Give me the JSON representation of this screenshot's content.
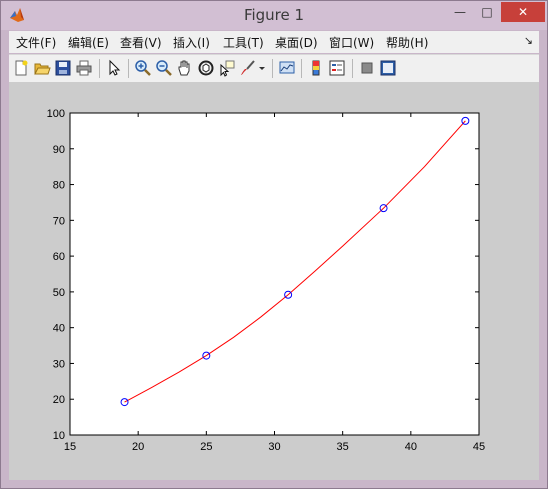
{
  "window": {
    "title": "Figure 1",
    "min_glyph": "—",
    "max_glyph": "□",
    "close_glyph": "✕"
  },
  "menu": {
    "items": [
      "文件(F)",
      "编辑(E)",
      "查看(V)",
      "插入(I)",
      "工具(T)",
      "桌面(D)",
      "窗口(W)",
      "帮助(H)"
    ],
    "overflow_glyph": "↘"
  },
  "toolbar": {
    "icons": [
      "new-figure-icon",
      "open-file-icon",
      "save-icon",
      "print-icon",
      "edit-plot-arrow-icon",
      "zoom-in-icon",
      "zoom-out-icon",
      "pan-hand-icon",
      "rotate-3d-icon",
      "data-cursor-icon",
      "brush-icon",
      "brush-dropdown-icon",
      "link-plot-icon",
      "colorbar-icon",
      "legend-icon",
      "hide-plot-tools-icon",
      "show-plot-tools-icon"
    ]
  },
  "chart_data": {
    "type": "line",
    "title": "",
    "xlabel": "",
    "ylabel": "",
    "xlim": [
      15,
      45
    ],
    "ylim": [
      10,
      100
    ],
    "xticks": [
      15,
      20,
      25,
      30,
      35,
      40,
      45
    ],
    "yticks": [
      10,
      20,
      30,
      40,
      50,
      60,
      70,
      80,
      90,
      100
    ],
    "grid": false,
    "series": [
      {
        "style": "line",
        "color": "#ff0000",
        "x": [
          19,
          21,
          23,
          25,
          27,
          29,
          31,
          33,
          35,
          38,
          41,
          44
        ],
        "y": [
          19.2,
          23.3,
          27.6,
          32.2,
          37.3,
          43.0,
          49.2,
          55.9,
          62.8,
          73.4,
          85.0,
          97.8
        ]
      },
      {
        "style": "markers",
        "marker": "circle",
        "color": "#0000ff",
        "x": [
          19,
          25,
          31,
          38,
          44
        ],
        "y": [
          19.2,
          32.2,
          49.2,
          73.4,
          97.8
        ]
      }
    ]
  }
}
